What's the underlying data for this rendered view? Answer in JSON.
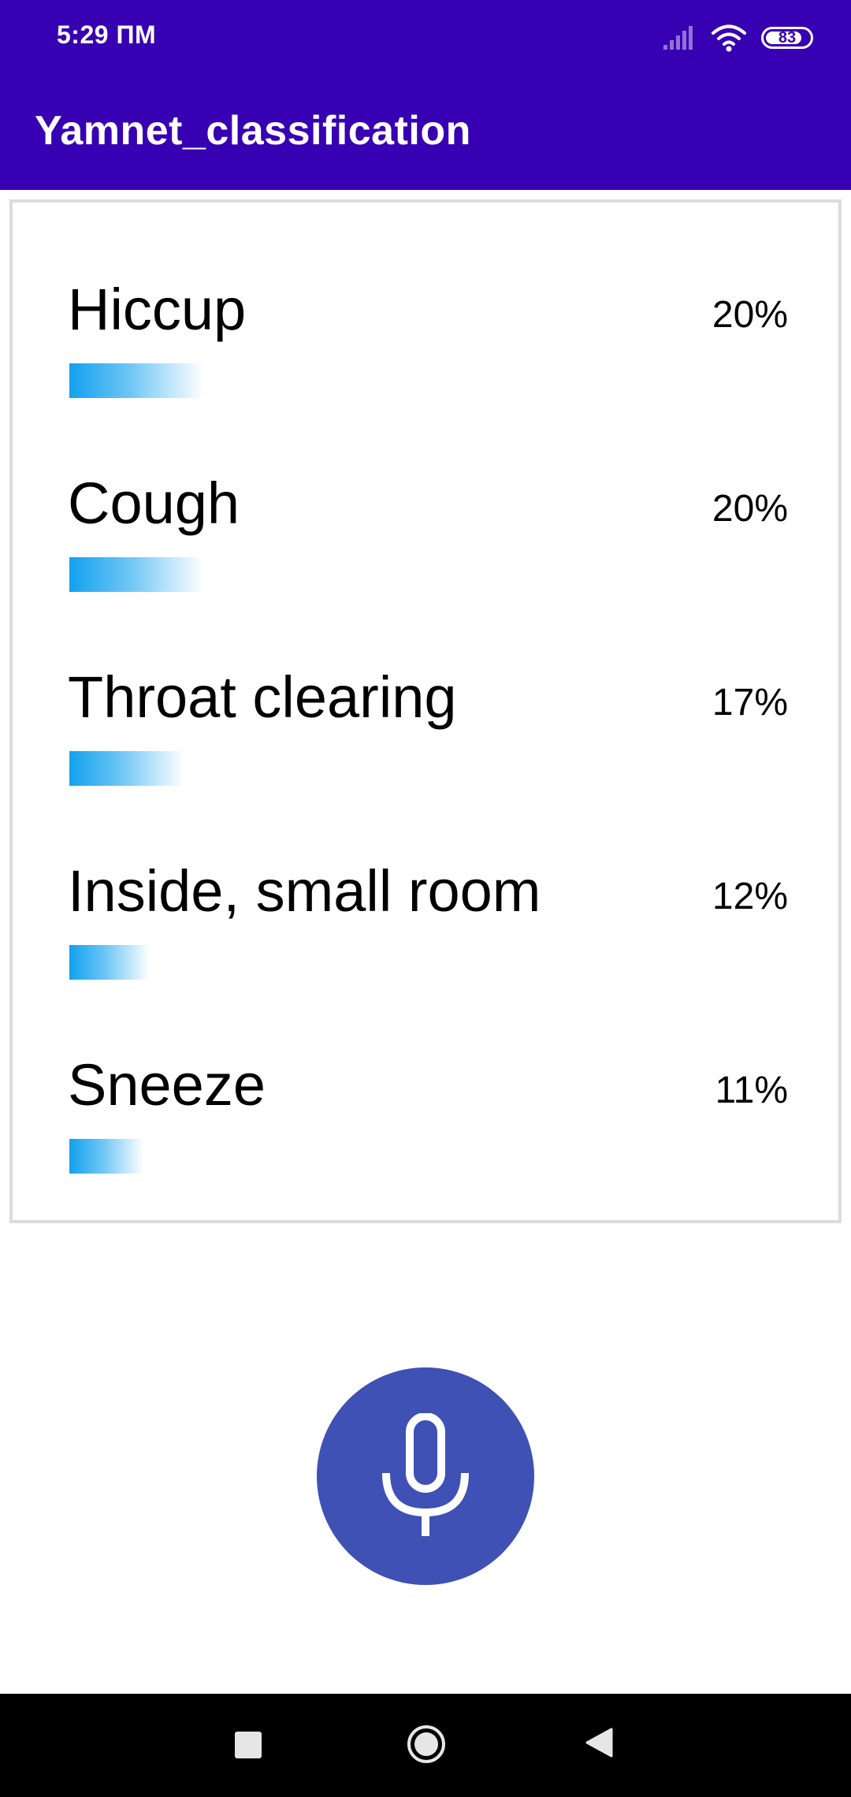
{
  "status_bar": {
    "time": "5:29 ПМ",
    "battery_level": "83",
    "battery_fraction": 0.83,
    "icons": [
      "signal-icon",
      "wifi-icon",
      "battery-icon"
    ]
  },
  "app_bar": {
    "title": "Yamnet_classification"
  },
  "results": [
    {
      "label": "Hiccup",
      "score": "20%",
      "fraction": 0.2
    },
    {
      "label": "Cough",
      "score": "20%",
      "fraction": 0.2
    },
    {
      "label": "Throat clearing",
      "score": "17%",
      "fraction": 0.17
    },
    {
      "label": "Inside, small room",
      "score": "12%",
      "fraction": 0.12
    },
    {
      "label": "Sneeze",
      "score": "11%",
      "fraction": 0.11
    }
  ],
  "mic_button": {
    "icon": "microphone-icon"
  },
  "nav_bar": {
    "icons": [
      "recents-icon",
      "home-icon",
      "back-icon"
    ]
  },
  "colors": {
    "app_bar": "#3700b3",
    "fab": "#3f51b5",
    "bar_start": "#12a1ee",
    "card_border": "#dcdcdc",
    "nav_bar": "#000000"
  }
}
